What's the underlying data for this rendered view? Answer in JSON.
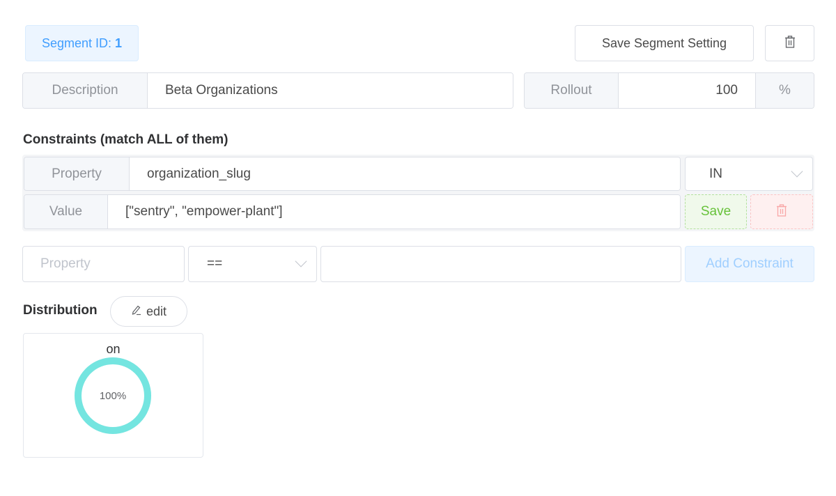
{
  "segment": {
    "id_label": "Segment ID:",
    "id_value": "1",
    "save_button": "Save Segment Setting",
    "delete_icon": "trash-icon"
  },
  "description": {
    "label": "Description",
    "value": "Beta Organizations"
  },
  "rollout": {
    "label": "Rollout",
    "value": "100",
    "unit": "%"
  },
  "constraints": {
    "title": "Constraints (match ALL of them)",
    "items": [
      {
        "property_label": "Property",
        "property": "organization_slug",
        "operator": "IN",
        "value_label": "Value",
        "value": "[\"sentry\", \"empower-plant\"]",
        "save_label": "Save",
        "delete_icon": "trash-icon"
      }
    ],
    "new": {
      "property_placeholder": "Property",
      "operator": "==",
      "value": "",
      "add_label": "Add Constraint"
    }
  },
  "distribution": {
    "title": "Distribution",
    "edit_label": "edit",
    "edit_icon": "pencil-icon",
    "variants": [
      {
        "key": "on",
        "percent": 100,
        "percent_label": "100%",
        "color": "#74e5e0"
      }
    ]
  },
  "colors": {
    "primary": "#409eff",
    "success": "#67c23a",
    "danger": "#f56c6c",
    "donut": "#74e5e0"
  }
}
